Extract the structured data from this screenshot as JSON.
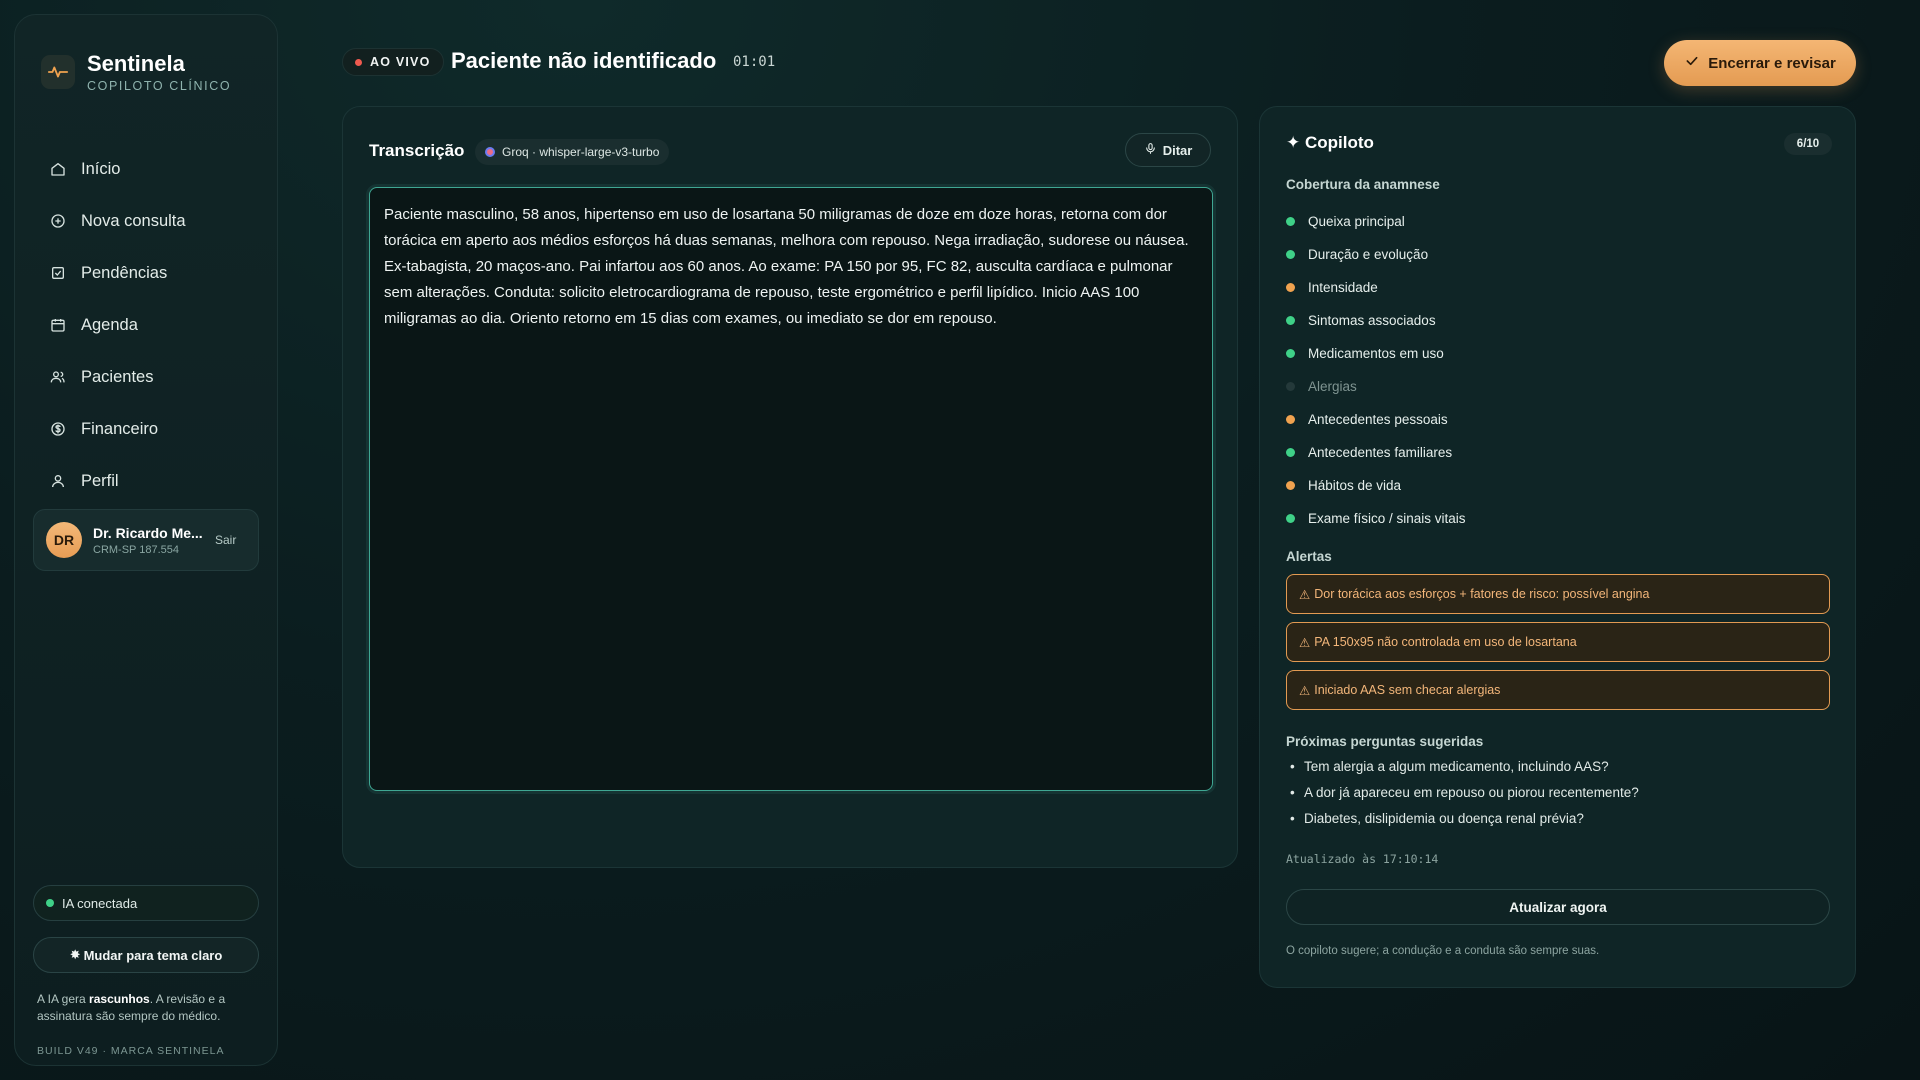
{
  "brand": {
    "name": "Sentinela",
    "subtitle": "COPILOTO CLÍNICO"
  },
  "nav": [
    {
      "label": "Início",
      "icon": "home-icon"
    },
    {
      "label": "Nova consulta",
      "icon": "plus-circle-icon"
    },
    {
      "label": "Pendências",
      "icon": "checklist-icon"
    },
    {
      "label": "Agenda",
      "icon": "calendar-icon"
    },
    {
      "label": "Pacientes",
      "icon": "users-icon"
    },
    {
      "label": "Financeiro",
      "icon": "dollar-icon"
    },
    {
      "label": "Perfil",
      "icon": "user-icon"
    }
  ],
  "user": {
    "initials": "DR",
    "name": "Dr. Ricardo Me...",
    "crm": "CRM-SP 187.554",
    "logout": "Sair"
  },
  "status": {
    "ia": "IA conectada"
  },
  "theme_button": "Mudar para tema claro",
  "disclaimer": {
    "pre": "A IA gera ",
    "bold": "rascunhos",
    "post": ". A revisão e a assinatura são sempre do médico."
  },
  "build": "BUILD V49 · MARCA SENTINELA",
  "header": {
    "live": "AO VIVO",
    "title": "Paciente não identificado",
    "timer": "01:01",
    "end_button": "Encerrar e revisar"
  },
  "transcription": {
    "title": "Transcrição",
    "model": "Groq · whisper-large-v3-turbo",
    "dictate": "Ditar",
    "text": "Paciente masculino, 58 anos, hipertenso em uso de losartana 50 miligramas de doze em doze horas, retorna com dor torácica em aperto aos médios esforços há duas semanas, melhora com repouso. Nega irradiação, sudorese ou náusea. Ex-tabagista, 20 maços-ano. Pai infartou aos 60 anos. Ao exame: PA 150 por 95, FC 82, ausculta cardíaca e pulmonar sem alterações. Conduta: solicito eletrocardiograma de repouso, teste ergométrico e perfil lipídico. Inicio AAS 100 miligramas ao dia. Oriento retorno em 15 dias com exames, ou imediato se dor em repouso."
  },
  "copilot": {
    "title": "✦ Copiloto",
    "count": "6/10",
    "coverage_title": "Cobertura da anamnese",
    "coverage": [
      {
        "label": "Queixa principal",
        "status": "done",
        "color": "#3fd188"
      },
      {
        "label": "Duração e evolução",
        "status": "done",
        "color": "#3fd188"
      },
      {
        "label": "Intensidade",
        "status": "partial",
        "color": "#f0a24f"
      },
      {
        "label": "Sintomas associados",
        "status": "done",
        "color": "#3fd188"
      },
      {
        "label": "Medicamentos em uso",
        "status": "done",
        "color": "#3fd188"
      },
      {
        "label": "Alergias",
        "status": "missing",
        "color": "#24393a"
      },
      {
        "label": "Antecedentes pessoais",
        "status": "partial",
        "color": "#f0a24f"
      },
      {
        "label": "Antecedentes familiares",
        "status": "done",
        "color": "#3fd188"
      },
      {
        "label": "Hábitos de vida",
        "status": "partial",
        "color": "#f0a24f"
      },
      {
        "label": "Exame físico / sinais vitais",
        "status": "done",
        "color": "#3fd188"
      }
    ],
    "alerts_title": "Alertas",
    "alerts": [
      "Dor torácica aos esforços + fatores de risco: possível angina",
      "PA 150x95 não controlada em uso de losartana",
      "Iniciado AAS sem checar alergias"
    ],
    "questions_title": "Próximas perguntas sugeridas",
    "questions": [
      "Tem alergia a algum medicamento, incluindo AAS?",
      "A dor já apareceu em repouso ou piorou recentemente?",
      "Diabetes, dislipidemia ou doença renal prévia?"
    ],
    "updated": "Atualizado às 17:10:14",
    "refresh": "Atualizar agora",
    "note": "O copiloto sugere; a condução e a conduta são sempre suas."
  },
  "colors": {
    "accent": "#e9a45f",
    "success": "#3fd188",
    "warning": "#f0a24f",
    "live": "#ef5a4f"
  }
}
